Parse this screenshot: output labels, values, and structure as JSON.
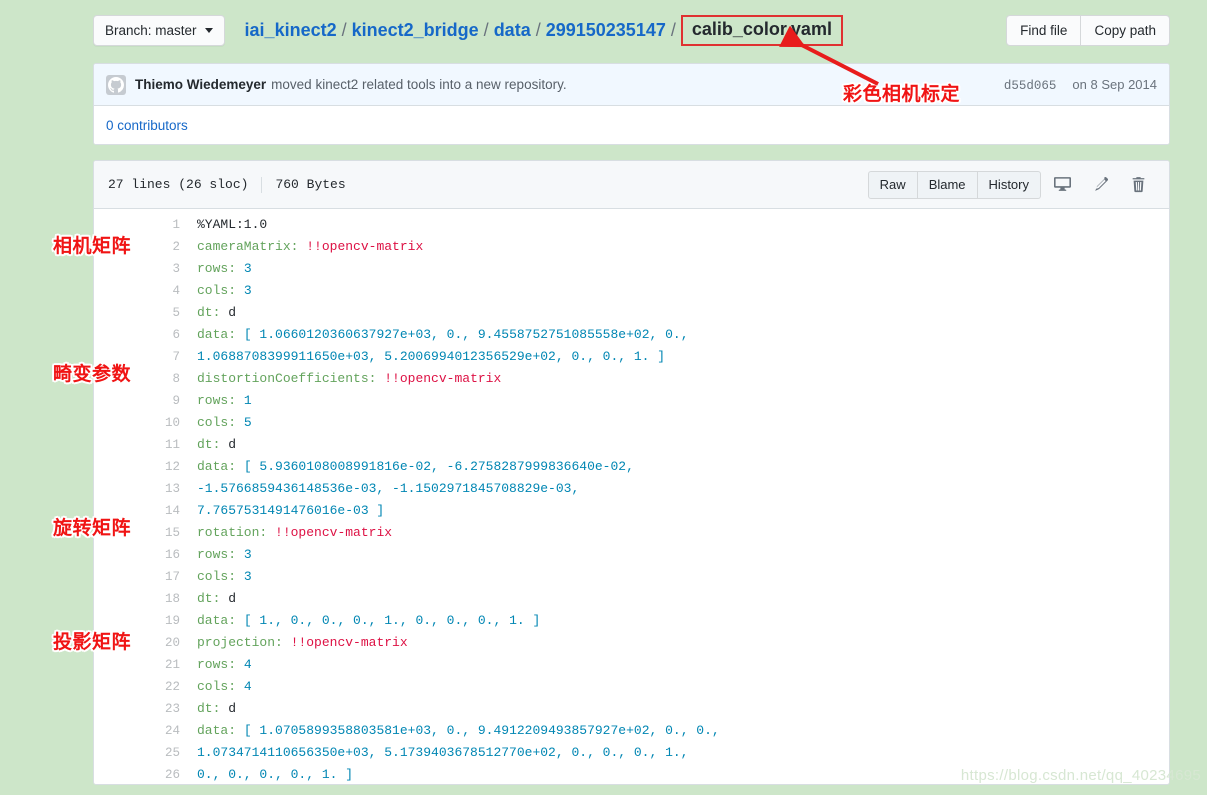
{
  "topbar": {
    "branch_label": "Branch: master",
    "breadcrumb": [
      {
        "text": "iai_kinect2",
        "link": true
      },
      {
        "text": "kinect2_bridge",
        "link": true
      },
      {
        "text": "data",
        "link": true
      },
      {
        "text": "299150235147",
        "link": true
      }
    ],
    "separator": "/",
    "filename": "calib_color.yaml",
    "find_file_label": "Find file",
    "copy_path_label": "Copy path"
  },
  "commit": {
    "author": "Thiemo Wiedemeyer",
    "message": "moved kinect2 related tools into a new repository.",
    "sha": "d55d065",
    "date": "on 8 Sep 2014",
    "contributors": "0 contributors"
  },
  "file": {
    "lines_info": "27 lines (26 sloc)",
    "size": "760 Bytes",
    "raw_label": "Raw",
    "blame_label": "Blame",
    "history_label": "History",
    "icons": [
      "desktop-icon",
      "pencil-icon",
      "trash-icon"
    ]
  },
  "code_lines": [
    {
      "num": "1",
      "tokens": [
        {
          "t": "p",
          "v": "%YAML:1.0"
        }
      ]
    },
    {
      "num": "2",
      "tokens": [
        {
          "t": "k",
          "v": "cameraMatrix:"
        },
        {
          "t": "p",
          "v": " "
        },
        {
          "t": "t",
          "v": "!!opencv-matrix"
        }
      ]
    },
    {
      "num": "3",
      "tokens": [
        {
          "t": "k",
          "v": "   rows:"
        },
        {
          "t": "p",
          "v": " "
        },
        {
          "t": "n",
          "v": "3"
        }
      ]
    },
    {
      "num": "4",
      "tokens": [
        {
          "t": "k",
          "v": "   cols:"
        },
        {
          "t": "p",
          "v": " "
        },
        {
          "t": "n",
          "v": "3"
        }
      ]
    },
    {
      "num": "5",
      "tokens": [
        {
          "t": "k",
          "v": "   dt:"
        },
        {
          "t": "p",
          "v": " d"
        }
      ]
    },
    {
      "num": "6",
      "tokens": [
        {
          "t": "k",
          "v": "   data:"
        },
        {
          "t": "p",
          "v": " "
        },
        {
          "t": "n",
          "v": "[ 1.0660120360637927e+03, 0., 9.4558752751085558e+02, 0.,"
        }
      ]
    },
    {
      "num": "7",
      "tokens": [
        {
          "t": "n",
          "v": "       1.0688708399911650e+03, 5.2006994012356529e+02, 0., 0., 1. ]"
        }
      ]
    },
    {
      "num": "8",
      "tokens": [
        {
          "t": "k",
          "v": "distortionCoefficients:"
        },
        {
          "t": "p",
          "v": " "
        },
        {
          "t": "t",
          "v": "!!opencv-matrix"
        }
      ]
    },
    {
      "num": "9",
      "tokens": [
        {
          "t": "k",
          "v": "   rows:"
        },
        {
          "t": "p",
          "v": " "
        },
        {
          "t": "n",
          "v": "1"
        }
      ]
    },
    {
      "num": "10",
      "tokens": [
        {
          "t": "k",
          "v": "   cols:"
        },
        {
          "t": "p",
          "v": " "
        },
        {
          "t": "n",
          "v": "5"
        }
      ]
    },
    {
      "num": "11",
      "tokens": [
        {
          "t": "k",
          "v": "   dt:"
        },
        {
          "t": "p",
          "v": " d"
        }
      ]
    },
    {
      "num": "12",
      "tokens": [
        {
          "t": "k",
          "v": "   data:"
        },
        {
          "t": "p",
          "v": " "
        },
        {
          "t": "n",
          "v": "[ 5.9360108008991816e-02, -6.2758287999836640e-02,"
        }
      ]
    },
    {
      "num": "13",
      "tokens": [
        {
          "t": "n",
          "v": "       -1.5766859436148536e-03, -1.1502971845708829e-03,"
        }
      ]
    },
    {
      "num": "14",
      "tokens": [
        {
          "t": "n",
          "v": "       7.7657531491476016e-03 ]"
        }
      ]
    },
    {
      "num": "15",
      "tokens": [
        {
          "t": "k",
          "v": "rotation:"
        },
        {
          "t": "p",
          "v": " "
        },
        {
          "t": "t",
          "v": "!!opencv-matrix"
        }
      ]
    },
    {
      "num": "16",
      "tokens": [
        {
          "t": "k",
          "v": "   rows:"
        },
        {
          "t": "p",
          "v": " "
        },
        {
          "t": "n",
          "v": "3"
        }
      ]
    },
    {
      "num": "17",
      "tokens": [
        {
          "t": "k",
          "v": "   cols:"
        },
        {
          "t": "p",
          "v": " "
        },
        {
          "t": "n",
          "v": "3"
        }
      ]
    },
    {
      "num": "18",
      "tokens": [
        {
          "t": "k",
          "v": "   dt:"
        },
        {
          "t": "p",
          "v": " d"
        }
      ]
    },
    {
      "num": "19",
      "tokens": [
        {
          "t": "k",
          "v": "   data:"
        },
        {
          "t": "p",
          "v": " "
        },
        {
          "t": "n",
          "v": "[ 1., 0., 0., 0., 1., 0., 0., 0., 1. ]"
        }
      ]
    },
    {
      "num": "20",
      "tokens": [
        {
          "t": "k",
          "v": "projection:"
        },
        {
          "t": "p",
          "v": " "
        },
        {
          "t": "t",
          "v": "!!opencv-matrix"
        }
      ]
    },
    {
      "num": "21",
      "tokens": [
        {
          "t": "k",
          "v": "   rows:"
        },
        {
          "t": "p",
          "v": " "
        },
        {
          "t": "n",
          "v": "4"
        }
      ]
    },
    {
      "num": "22",
      "tokens": [
        {
          "t": "k",
          "v": "   cols:"
        },
        {
          "t": "p",
          "v": " "
        },
        {
          "t": "n",
          "v": "4"
        }
      ]
    },
    {
      "num": "23",
      "tokens": [
        {
          "t": "k",
          "v": "   dt:"
        },
        {
          "t": "p",
          "v": " d"
        }
      ]
    },
    {
      "num": "24",
      "tokens": [
        {
          "t": "k",
          "v": "   data:"
        },
        {
          "t": "p",
          "v": " "
        },
        {
          "t": "n",
          "v": "[ 1.0705899358803581e+03, 0., 9.4912209493857927e+02, 0., 0.,"
        }
      ]
    },
    {
      "num": "25",
      "tokens": [
        {
          "t": "n",
          "v": "       1.0734714110656350e+03, 5.1739403678512770e+02, 0., 0., 0., 1.,"
        }
      ]
    },
    {
      "num": "26",
      "tokens": [
        {
          "t": "n",
          "v": "       0., 0., 0., 0., 1. ]"
        }
      ]
    }
  ],
  "annotations": {
    "title_note": "彩色相机标定",
    "camera_matrix": "相机矩阵",
    "distortion": "畸变参数",
    "rotation": "旋转矩阵",
    "projection": "投影矩阵",
    "arrow_color": "#e81c1c"
  },
  "watermark": "https://blog.csdn.net/qq_40234695"
}
